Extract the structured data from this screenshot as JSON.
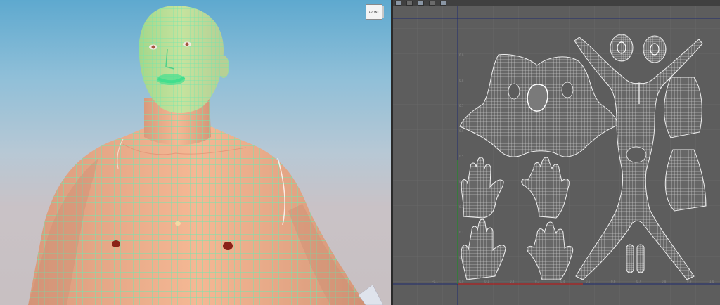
{
  "viewport": {
    "view_cube_label": "FRONT"
  },
  "uv_editor": {
    "toolbar_labels": [
      "",
      "",
      "",
      "",
      ""
    ],
    "axis_ticks_x": [
      "-0.1",
      "0.0",
      "0.1",
      "0.2",
      "0.3",
      "0.4",
      "0.5",
      "0.6",
      "0.7",
      "0.8",
      "0.9",
      "1.0"
    ],
    "axis_ticks_y": [
      "0.9",
      "0.8",
      "0.7",
      "0.6",
      "0.5",
      "0.4",
      "0.3",
      "0.2",
      "0.1"
    ]
  },
  "colors": {
    "wire": "#6fe8b0",
    "skin": "#f0b08c",
    "uv_background": "#5d5d5d",
    "uv_grid": "#6a6a6a",
    "uv_island": "#e6e6e6"
  }
}
